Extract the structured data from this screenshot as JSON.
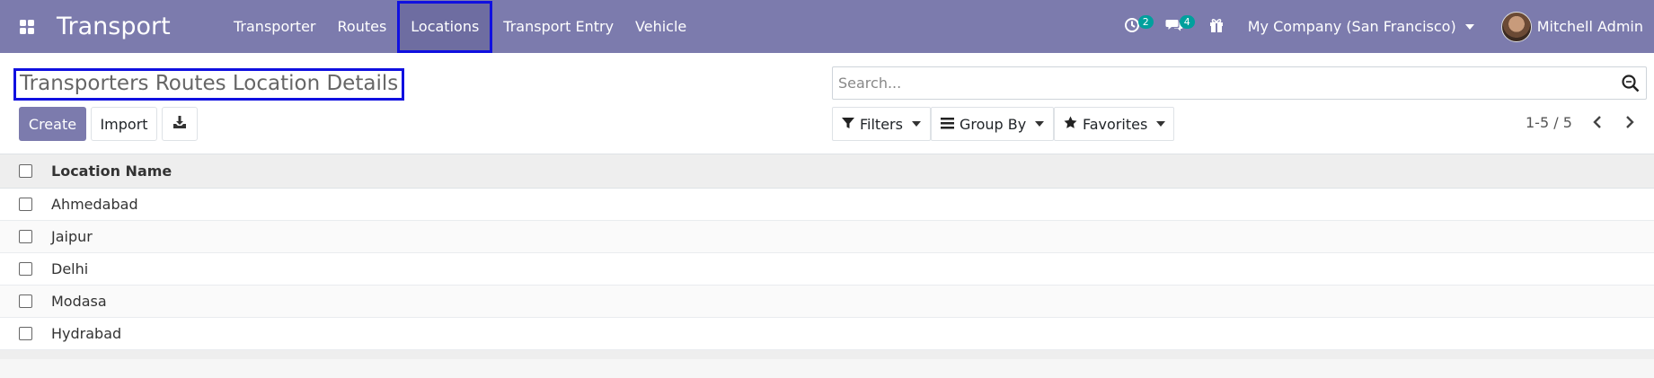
{
  "navbar": {
    "app_title": "Transport",
    "menu": [
      {
        "label": "Transporter",
        "active": false
      },
      {
        "label": "Routes",
        "active": false
      },
      {
        "label": "Locations",
        "active": true
      },
      {
        "label": "Transport Entry",
        "active": false
      },
      {
        "label": "Vehicle",
        "active": false
      }
    ],
    "activity_count": "2",
    "messages_count": "4",
    "company": "My Company (San Francisco)",
    "user": "Mitchell Admin",
    "colors": {
      "navbar_bg": "#7c7bad",
      "badge": "#00a09d",
      "highlight_border": "#1010e0"
    }
  },
  "control_panel": {
    "title": "Transporters Routes Location Details",
    "create_label": "Create",
    "import_label": "Import",
    "search_placeholder": "Search...",
    "filters_label": "Filters",
    "groupby_label": "Group By",
    "favorites_label": "Favorites",
    "pager": "1-5 / 5"
  },
  "list": {
    "column_header": "Location Name",
    "rows": [
      "Ahmedabad",
      "Jaipur",
      "Delhi",
      "Modasa",
      "Hydrabad"
    ]
  }
}
